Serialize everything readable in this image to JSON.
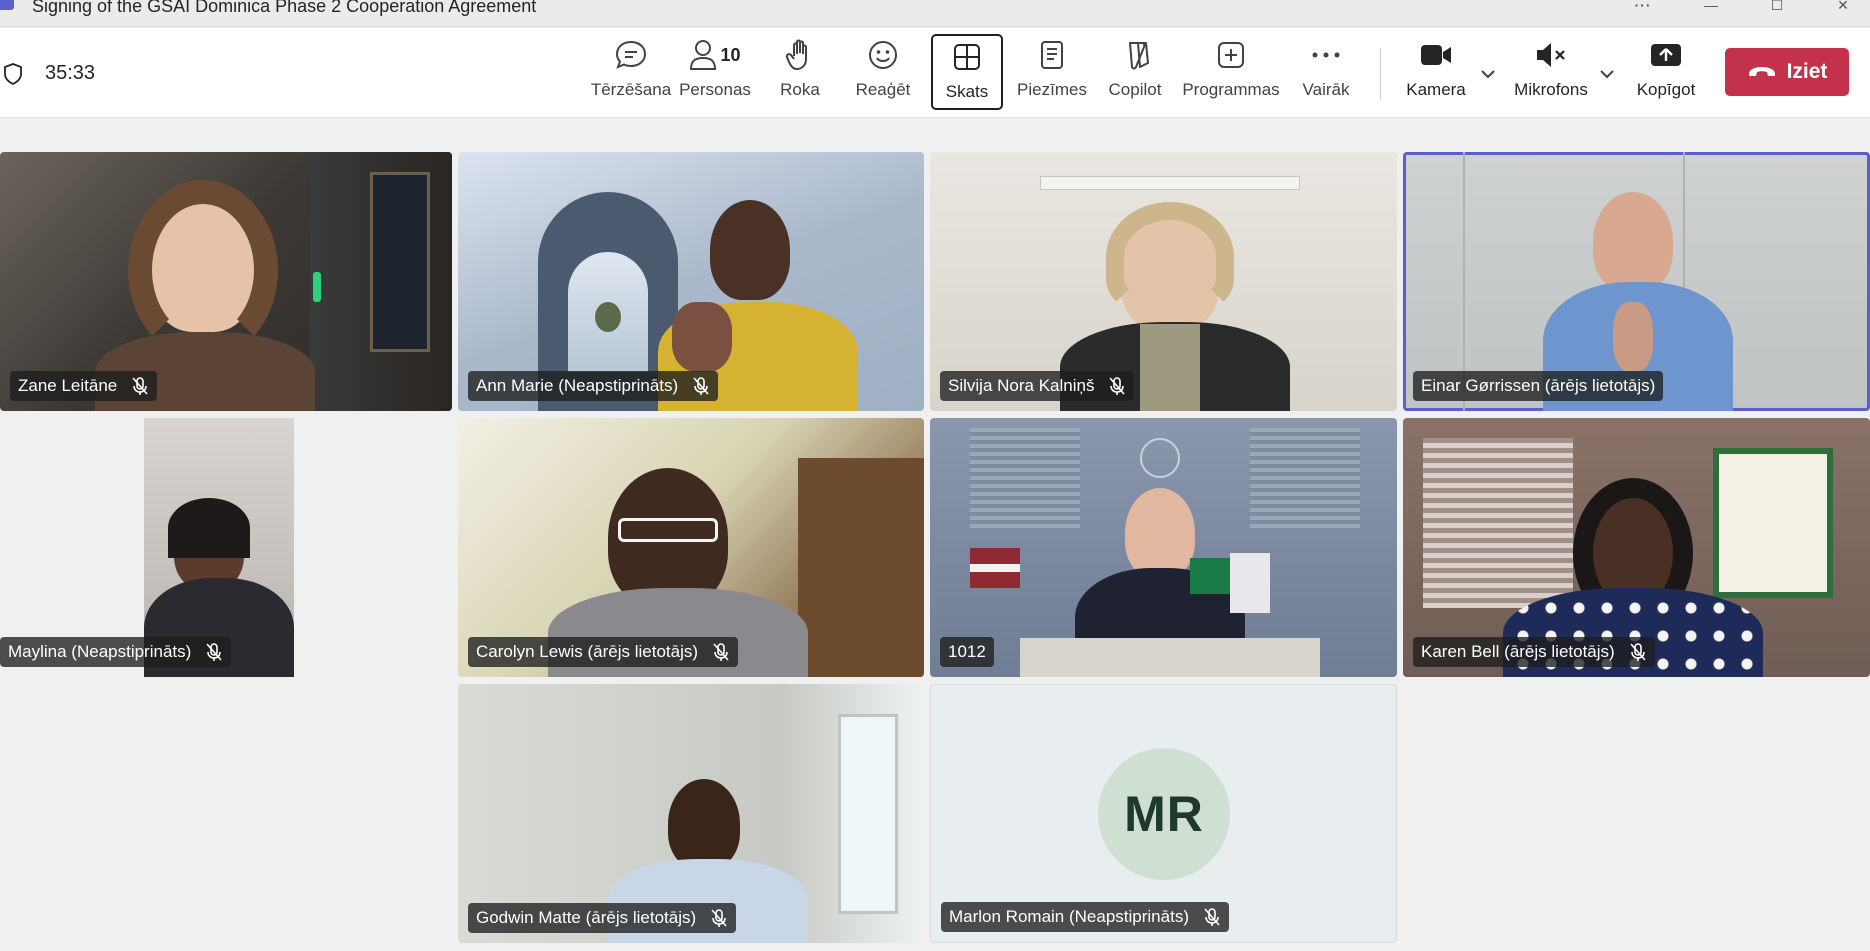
{
  "window": {
    "title": "Signing of the GSAI Dominica Phase 2 Cooperation Agreement",
    "more_label": "···",
    "min_label": "—",
    "max_label": "☐",
    "close_label": "✕"
  },
  "toolbar": {
    "timer": "35:33",
    "chat_label": "Tērzēšana",
    "people_label": "Personas",
    "people_count": "10",
    "raise_label": "Roka",
    "react_label": "Reaģēt",
    "view_label": "Skats",
    "notes_label": "Piezīmes",
    "copilot_label": "Copilot",
    "apps_label": "Programmas",
    "more_label": "Vairāk",
    "camera_label": "Kamera",
    "mic_label": "Mikrofons",
    "share_label": "Kopīgot",
    "leave_label": "Iziet",
    "leave_color": "#c4314b"
  },
  "participants": [
    {
      "name": "Zane Leitāne",
      "muted": true
    },
    {
      "name": "Ann Marie (Neapstiprināts)",
      "muted": true
    },
    {
      "name": "Silvija Nora Kalniņš",
      "muted": true
    },
    {
      "name": "Einar Gørrissen (ārējs lietotājs)",
      "muted": false,
      "speaking": true
    },
    {
      "name": "Maylina (Neapstiprināts)",
      "muted": true
    },
    {
      "name": "Carolyn Lewis (ārējs lietotājs)",
      "muted": true
    },
    {
      "name": "1012",
      "muted": false
    },
    {
      "name": "Karen Bell (ārējs lietotājs)",
      "muted": true
    },
    {
      "name": "Godwin Matte (ārējs lietotājs)",
      "muted": true
    },
    {
      "name": "Marlon Romain (Neapstiprināts)",
      "muted": true,
      "initials": "MR"
    }
  ],
  "colors": {
    "accent": "#5b5fc7",
    "leave": "#c4314b",
    "avatar_bg": "#cfe0d2"
  }
}
